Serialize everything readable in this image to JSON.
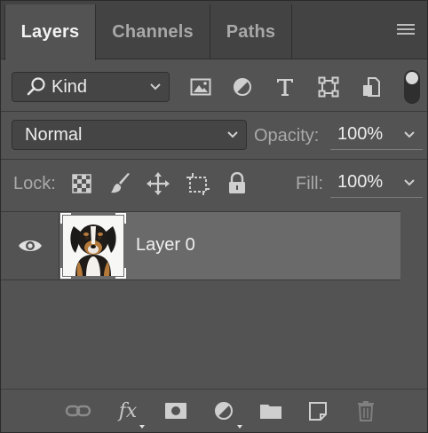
{
  "tabs": [
    {
      "label": "Layers",
      "active": true
    },
    {
      "label": "Channels",
      "active": false
    },
    {
      "label": "Paths",
      "active": false
    }
  ],
  "filter": {
    "kind_label": "Kind",
    "icons": [
      "image-filter-icon",
      "adjustment-filter-icon",
      "type-filter-icon",
      "shape-filter-icon",
      "smart-object-filter-icon"
    ],
    "toggle_on": true
  },
  "blend": {
    "mode": "Normal",
    "opacity_label": "Opacity:",
    "opacity_value": "100%"
  },
  "lock": {
    "label": "Lock:",
    "icons": [
      "lock-transparent-pixels-icon",
      "lock-image-pixels-icon",
      "lock-position-icon",
      "lock-artboard-icon",
      "lock-all-icon"
    ],
    "fill_label": "Fill:",
    "fill_value": "100%"
  },
  "layers": [
    {
      "name": "Layer 0",
      "visible": true,
      "selected": true,
      "thumbnail": "puppy-photo"
    }
  ],
  "bottom_icons": [
    "link-layers-icon",
    "fx-icon",
    "layer-mask-icon",
    "adjustment-layer-icon",
    "group-folder-icon",
    "new-layer-icon",
    "delete-layer-icon"
  ],
  "colors": {
    "panel_bg": "#535353",
    "tabbar_bg": "#434343",
    "selected_layer_bg": "#6a6a6a"
  }
}
